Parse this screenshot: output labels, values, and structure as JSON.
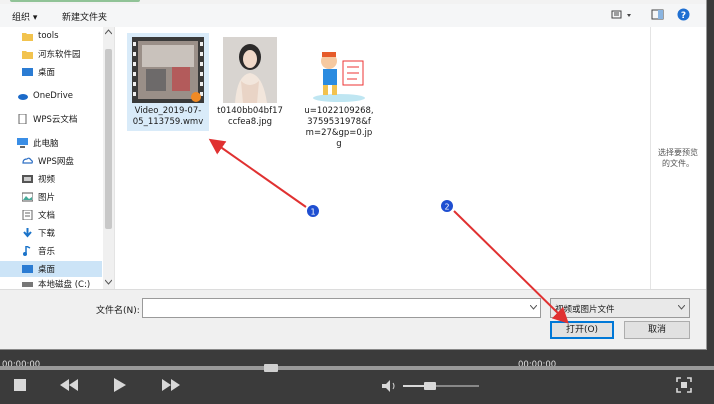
{
  "toolbar": {
    "organize": "组织 ▾",
    "new_folder": "新建文件夹",
    "help": "?"
  },
  "sidebar": {
    "items": [
      {
        "label": "tools",
        "icon": "folder-icon"
      },
      {
        "label": "河东软件园",
        "icon": "folder-icon"
      },
      {
        "label": "桌面",
        "icon": "desktop-icon"
      },
      {
        "label": "OneDrive",
        "icon": "cloud-icon"
      },
      {
        "label": "WPS云文档",
        "icon": "doc-icon"
      },
      {
        "label": "此电脑",
        "icon": "computer-icon"
      },
      {
        "label": "WPS网盘",
        "icon": "cloud-drive-icon"
      },
      {
        "label": "视频",
        "icon": "video-icon"
      },
      {
        "label": "图片",
        "icon": "picture-icon"
      },
      {
        "label": "文档",
        "icon": "document-icon"
      },
      {
        "label": "下载",
        "icon": "download-icon"
      },
      {
        "label": "音乐",
        "icon": "music-icon"
      },
      {
        "label": "桌面",
        "icon": "desktop-icon"
      },
      {
        "label": "本地磁盘 (C:)",
        "icon": "drive-icon"
      }
    ]
  },
  "files": [
    {
      "name": "Video_2019-07-05_113759.wmv",
      "line1": "Video_2019-07-",
      "line2": "05_113759.wmv",
      "type": "video"
    },
    {
      "name": "t0140bb04bf17ccfea8.jpg",
      "line1": "t0140bb04bf17",
      "line2": "ccfea8.jpg",
      "type": "photo"
    },
    {
      "name": "u=1022109268,3759531978&fm=27&gp=0.jpg",
      "line1": "u=1022109268,",
      "line2": "3759531978&f",
      "line3": "m=27&gp=0.jp",
      "line4": "g",
      "type": "cartoon"
    }
  ],
  "preview": {
    "text1": "选择要预览",
    "text2": "的文件。"
  },
  "annotations": {
    "step1": "1",
    "step2": "2",
    "arrow_color": "#e03131"
  },
  "bottom": {
    "filename_label": "文件名(N):",
    "filename_value": "",
    "filter_value": "视频或图片文件",
    "open_label": "打开(O)",
    "cancel_label": "取消"
  },
  "player": {
    "time_left": "00:00:00",
    "time_right": "00:00:00",
    "seek_progress": 0.38,
    "volume_level": 0.35
  }
}
